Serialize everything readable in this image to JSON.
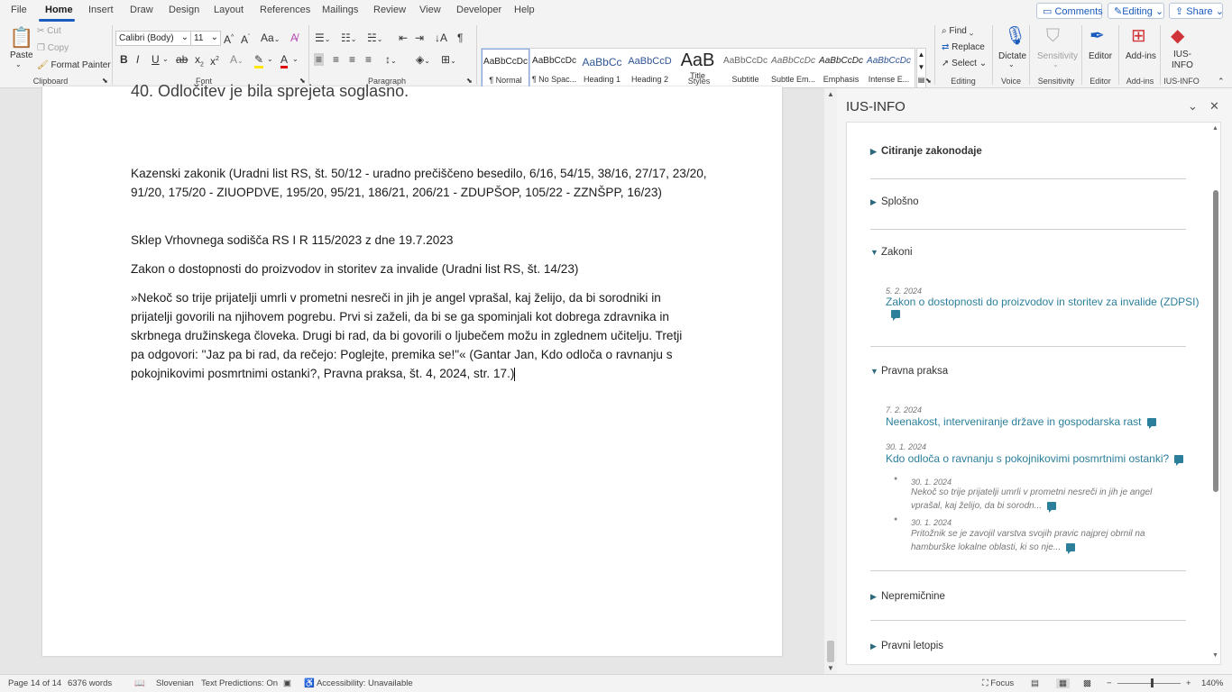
{
  "tabs": [
    "File",
    "Home",
    "Insert",
    "Draw",
    "Design",
    "Layout",
    "References",
    "Mailings",
    "Review",
    "View",
    "Developer",
    "Help"
  ],
  "top_buttons": {
    "comments": "Comments",
    "editing": "Editing",
    "share": "Share"
  },
  "clipboard": {
    "paste": "Paste",
    "cut": "Cut",
    "copy": "Copy",
    "format_painter": "Format Painter",
    "group": "Clipboard"
  },
  "font": {
    "name": "Calibri (Body)",
    "size": "11",
    "group": "Font"
  },
  "paragraph": {
    "group": "Paragraph"
  },
  "styles": {
    "items": [
      {
        "preview": "AaBbCcDc",
        "label": "¶ Normal"
      },
      {
        "preview": "AaBbCcDc",
        "label": "¶ No Spac..."
      },
      {
        "preview": "AaBbCc",
        "label": "Heading 1"
      },
      {
        "preview": "AaBbCcD",
        "label": "Heading 2"
      },
      {
        "preview": "AaB",
        "label": "Title"
      },
      {
        "preview": "AaBbCcDc",
        "label": "Subtitle"
      },
      {
        "preview": "AaBbCcDc",
        "label": "Subtle Em..."
      },
      {
        "preview": "AaBbCcDc",
        "label": "Emphasis"
      },
      {
        "preview": "AaBbCcDc",
        "label": "Intense E..."
      }
    ],
    "group": "Styles"
  },
  "editing": {
    "find": "Find",
    "replace": "Replace",
    "select": "Select",
    "group": "Editing"
  },
  "voice": {
    "dictate": "Dictate",
    "group": "Voice"
  },
  "sensitivity": {
    "label": "Sensitivity",
    "group": "Sensitivity"
  },
  "editor": {
    "label": "Editor",
    "group": "Editor"
  },
  "addins": {
    "label": "Add-ins",
    "group": "Add-ins"
  },
  "iusinfo": {
    "label1": "IUS-",
    "label2": "INFO",
    "group": "IUS-INFO"
  },
  "doc": {
    "heading_partial": "40. Odločitev je bila sprejeta soglasno.",
    "p1": "Kazenski zakonik  (Uradni list RS, št. 50/12 - uradno prečiščeno besedilo, 6/16, 54/15, 38/16, 27/17, 23/20, 91/20, 175/20 - ZIUOPDVE, 195/20, 95/21, 186/21, 206/21 - ZDUPŠOP, 105/22 - ZZNŠPP, 16/23)",
    "p2": "Sklep Vrhovnega sodišča RS I R 115/2023 z dne 19.7.2023",
    "p3": "Zakon o dostopnosti do proizvodov in storitev za invalide  (Uradni list RS, št. 14/23)",
    "p4": "»Nekoč so trije prijatelji umrli v prometni nesreči in jih je angel vprašal, kaj želijo, da bi sorodniki in prijatelji govorili na njihovem pogrebu. Prvi si zaželi, da bi se ga spominjali kot dobrega zdravnika in skrbnega družinskega človeka. Drugi bi rad, da bi govorili o ljubečem možu in zglednem učitelju. Tretji pa odgovori: \"Jaz pa bi rad, da rečejo: Poglejte, premika se!\"« (Gantar Jan, Kdo odloča o ravnanju s pokojnikovimi posmrtnimi ostanki?, Pravna praksa, št. 4, 2024, str. 17.)"
  },
  "pane": {
    "title": "IUS-INFO",
    "sections": {
      "s1": "Citiranje zakonodaje",
      "s2": "Splošno",
      "s3": "Zakoni",
      "s4": "Pravna praksa",
      "s5": "Nepremičnine",
      "s6": "Pravni letopis"
    },
    "zakoni_date": "5. 2. 2024",
    "zakoni_link": "Zakon o dostopnosti do proizvodov in storitev za invalide (ZDPSI)",
    "pp1_date": "7. 2. 2024",
    "pp1_link": "Neenakost, interveniranje države in gospodarska rast",
    "pp2_date": "30. 1. 2024",
    "pp2_link": "Kdo odloča o ravnanju s pokojnikovimi posmrtnimi ostanki?",
    "sub1_date": "30. 1. 2024",
    "sub1_text": "Nekoč so trije prijatelji umrli v prometni nesreči in jih je angel vprašal, kaj želijo, da bi sorodn...",
    "sub2_date": "30. 1. 2024",
    "sub2_text": "Pritožnik se je zavojil varstva svojih pravic najprej obrnil na hamburške lokalne oblasti, ki so nje..."
  },
  "status": {
    "page": "Page 14 of 14",
    "words": "6376 words",
    "language": "Slovenian",
    "predictions": "Text Predictions: On",
    "accessibility": "Accessibility: Unavailable",
    "focus": "Focus",
    "zoom": "140%"
  }
}
